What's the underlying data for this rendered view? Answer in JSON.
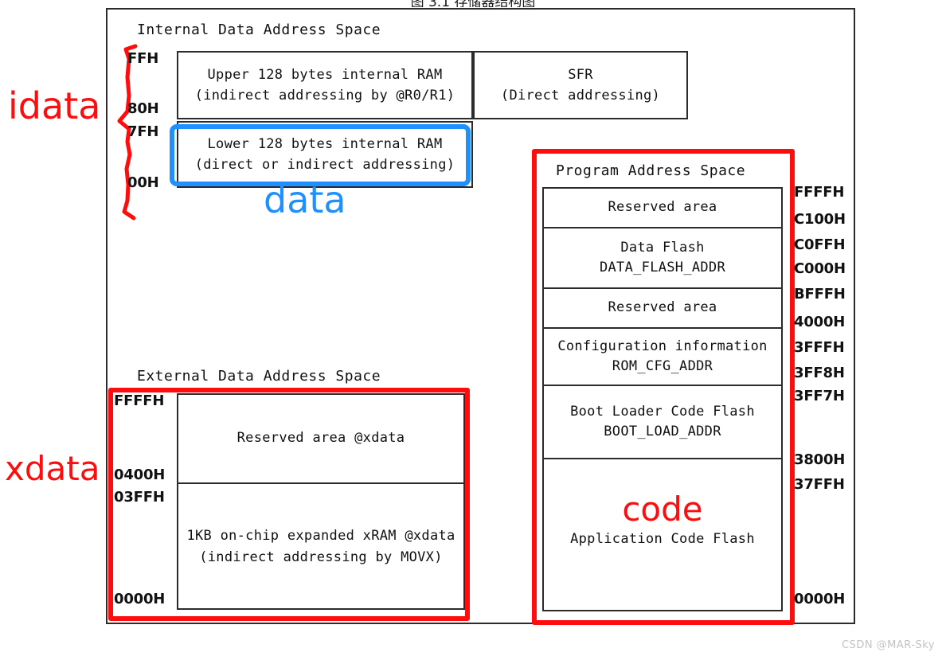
{
  "caption": "图 3.1 存储器结构图",
  "watermark": "CSDN @MAR-Sky",
  "colors": {
    "highlight_red": "#FD0D0D",
    "highlight_blue": "#1E90FF",
    "frame_black": "#2B2B2B"
  },
  "annotations": {
    "idata": "idata",
    "data": "data",
    "xdata": "xdata",
    "code": "code"
  },
  "internal_data": {
    "title": "Internal Data Address Space",
    "addresses": [
      "FFH",
      "80H",
      "7FH",
      "00H"
    ],
    "upper_ram": {
      "line1": "Upper 128 bytes internal RAM",
      "line2": "(indirect addressing by @R0/R1)"
    },
    "lower_ram": {
      "line1": "Lower 128 bytes internal RAM",
      "line2": "(direct or indirect addressing)"
    },
    "sfr": {
      "line1": "SFR",
      "line2": "(Direct addressing)"
    }
  },
  "external_data": {
    "title": "External Data Address Space",
    "addresses": [
      "FFFFH",
      "0400H",
      "03FFH",
      "0000H"
    ],
    "rows": [
      {
        "line1": "Reserved area @xdata",
        "line2": ""
      },
      {
        "line1": "1KB on-chip expanded xRAM @xdata",
        "line2": "(indirect addressing by MOVX)"
      }
    ]
  },
  "program_space": {
    "title": "Program Address Space",
    "addresses": [
      "FFFFH",
      "C100H",
      "C0FFH",
      "C000H",
      "BFFFH",
      "4000H",
      "3FFFH",
      "3FF8H",
      "3FF7H",
      "3800H",
      "37FFH",
      "0000H"
    ],
    "rows": [
      {
        "line1": "Reserved area",
        "line2": ""
      },
      {
        "line1": "Data Flash",
        "line2": "DATA_FLASH_ADDR"
      },
      {
        "line1": "Reserved area",
        "line2": ""
      },
      {
        "line1": "Configuration information",
        "line2": "ROM_CFG_ADDR"
      },
      {
        "line1": "Boot Loader Code Flash",
        "line2": "BOOT_LOAD_ADDR"
      },
      {
        "line1": "Application Code Flash",
        "line2": ""
      }
    ]
  }
}
